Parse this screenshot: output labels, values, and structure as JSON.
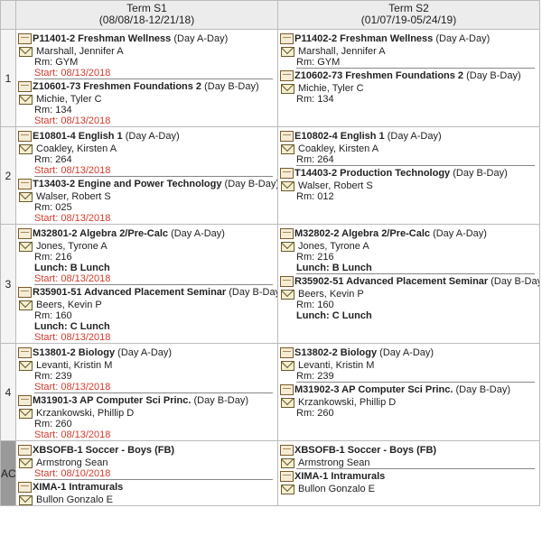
{
  "terms": [
    {
      "name": "Term S1",
      "dates": "(08/08/18-12/21/18)"
    },
    {
      "name": "Term S2",
      "dates": "(01/07/19-05/24/19)"
    }
  ],
  "periods": [
    {
      "label": "1",
      "s1": [
        {
          "code": "P11401-2 Freshman Wellness",
          "day": "(Day A-Day)",
          "teacher": "Marshall, Jennifer A",
          "room": "Rm: GYM",
          "start": "Start: 08/13/2018"
        },
        {
          "code": "Z10601-73 Freshmen Foundations 2",
          "day": "(Day B-Day)",
          "teacher": "Michie, Tyler C",
          "room": "Rm: 134",
          "start": "Start: 08/13/2018"
        }
      ],
      "s2": [
        {
          "code": "P11402-2 Freshman Wellness",
          "day": "(Day A-Day)",
          "teacher": "Marshall, Jennifer A",
          "room": "Rm: GYM"
        },
        {
          "code": "Z10602-73 Freshmen Foundations 2",
          "day": "(Day B-Day)",
          "teacher": "Michie, Tyler C",
          "room": "Rm: 134"
        }
      ]
    },
    {
      "label": "2",
      "s1": [
        {
          "code": "E10801-4 English 1",
          "day": "(Day A-Day)",
          "teacher": "Coakley, Kirsten A",
          "room": "Rm: 264",
          "start": "Start: 08/13/2018"
        },
        {
          "code": "T13403-2 Engine and Power Technology",
          "day": "(Day B-Day)",
          "teacher": "Walser, Robert S",
          "room": "Rm: 025",
          "start": "Start: 08/13/2018"
        }
      ],
      "s2": [
        {
          "code": "E10802-4 English 1",
          "day": "(Day A-Day)",
          "teacher": "Coakley, Kirsten A",
          "room": "Rm: 264"
        },
        {
          "code": "T14403-2 Production Technology",
          "day": "(Day B-Day)",
          "teacher": "Walser, Robert S",
          "room": "Rm: 012"
        }
      ]
    },
    {
      "label": "3",
      "s1": [
        {
          "code": "M32801-2 Algebra 2/Pre-Calc",
          "day": "(Day A-Day)",
          "teacher": "Jones, Tyrone A",
          "room": "Rm: 216",
          "lunch": "Lunch: B Lunch",
          "start": "Start: 08/13/2018"
        },
        {
          "code": "R35901-51 Advanced Placement Seminar",
          "day": "(Day B-Day)",
          "teacher": "Beers, Kevin P",
          "room": "Rm: 160",
          "lunch": "Lunch: C Lunch",
          "start": "Start: 08/13/2018"
        }
      ],
      "s2": [
        {
          "code": "M32802-2 Algebra 2/Pre-Calc",
          "day": "(Day A-Day)",
          "teacher": "Jones, Tyrone A",
          "room": "Rm: 216",
          "lunch": "Lunch: B Lunch"
        },
        {
          "code": "R35902-51 Advanced Placement Seminar",
          "day": "(Day B-Day)",
          "teacher": "Beers, Kevin P",
          "room": "Rm: 160",
          "lunch": "Lunch: C Lunch"
        }
      ]
    },
    {
      "label": "4",
      "s1": [
        {
          "code": "S13801-2 Biology",
          "day": "(Day A-Day)",
          "teacher": "Levanti, Kristin M",
          "room": "Rm: 239",
          "start": "Start: 08/13/2018"
        },
        {
          "code": "M31901-3 AP Computer Sci Princ.",
          "day": "(Day B-Day)",
          "teacher": "Krzankowski, Phillip D",
          "room": "Rm: 260",
          "start": "Start: 08/13/2018"
        }
      ],
      "s2": [
        {
          "code": "S13802-2 Biology",
          "day": "(Day A-Day)",
          "teacher": "Levanti, Kristin M",
          "room": "Rm: 239"
        },
        {
          "code": "M31902-3 AP Computer Sci Princ.",
          "day": "(Day B-Day)",
          "teacher": "Krzankowski, Phillip D",
          "room": "Rm: 260"
        }
      ]
    },
    {
      "label": "AC",
      "s1": [
        {
          "code": "XBSOFB-1 Soccer - Boys (FB)",
          "day": "",
          "teacher": "Armstrong Sean",
          "start": "Start: 08/10/2018"
        },
        {
          "code": "XIMA-1 Intramurals",
          "day": "",
          "teacher": "Bullon Gonzalo E"
        }
      ],
      "s2": [
        {
          "code": "XBSOFB-1 Soccer - Boys (FB)",
          "day": "",
          "teacher": "Armstrong Sean"
        },
        {
          "code": "XIMA-1 Intramurals",
          "day": "",
          "teacher": "Bullon Gonzalo E"
        }
      ]
    }
  ],
  "icons": {
    "note": "notepad-icon",
    "mail": "envelope-icon"
  },
  "colors": {
    "start_text": "#d33a2c",
    "header_bg": "#ececec",
    "ac_bg": "#999999"
  }
}
